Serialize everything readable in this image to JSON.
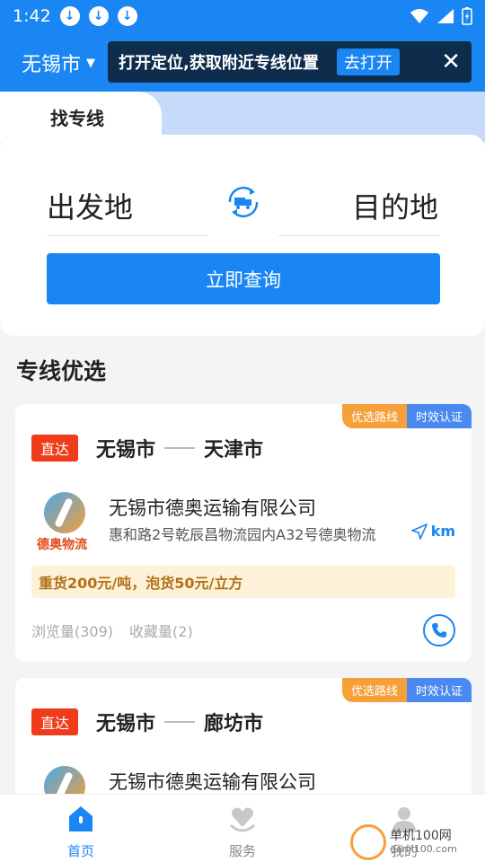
{
  "status_bar": {
    "time": "1:42"
  },
  "header": {
    "city": "无锡市",
    "location_prompt": "打开定位,获取附近专线位置",
    "open_button": "去打开"
  },
  "tabs": {
    "active": "找专线"
  },
  "search": {
    "origin": "出发地",
    "destination": "目的地",
    "query_button": "立即查询"
  },
  "section_title": "专线优选",
  "lines": [
    {
      "tags": [
        "优选路线",
        "时效认证"
      ],
      "badge": "直达",
      "from": "无锡市",
      "to": "天津市",
      "logo_text": "德奥物流",
      "company": "无锡市德奥运输有限公司",
      "address": "惠和路2号乾辰昌物流园内A32号德奥物流",
      "distance": "km",
      "price": "重货200元/吨，泡货50元/立方",
      "views": "浏览量(309)",
      "favorites": "收藏量(2)"
    },
    {
      "tags": [
        "优选路线",
        "时效认证"
      ],
      "badge": "直达",
      "from": "无锡市",
      "to": "廊坊市",
      "company": "无锡市德奥运输有限公司"
    }
  ],
  "bottom_nav": {
    "home": "首页",
    "service": "服务",
    "mine": "我的"
  },
  "watermark": {
    "site": "单机100网",
    "url": "danji100.com"
  },
  "colors": {
    "primary": "#1a86f3",
    "direct_badge": "#f03c1a",
    "tag_orange": "#f5a03a",
    "tag_blue": "#4a8af0"
  }
}
